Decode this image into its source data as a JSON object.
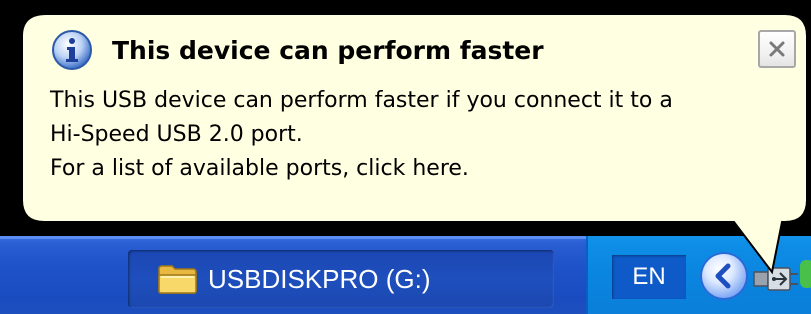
{
  "balloon": {
    "title": "This device can perform faster",
    "body_lines": [
      "This USB device can perform faster if you connect it to a",
      "Hi-Speed USB 2.0 port.",
      "For a list of available ports, click here."
    ],
    "icon": "info-icon",
    "close_icon": "close-icon"
  },
  "taskbar": {
    "task_button": {
      "label": "USBDISKPRO (G:)",
      "icon": "folder-icon"
    }
  },
  "tray": {
    "language": "EN",
    "expand_icon": "chevron-left-icon",
    "usb_icon": "usb-device-icon"
  },
  "colors": {
    "balloon_bg": "#ffffe1",
    "taskbar_blue": "#1e52c8",
    "tray_blue": "#0a85e0",
    "text": "#000000"
  }
}
